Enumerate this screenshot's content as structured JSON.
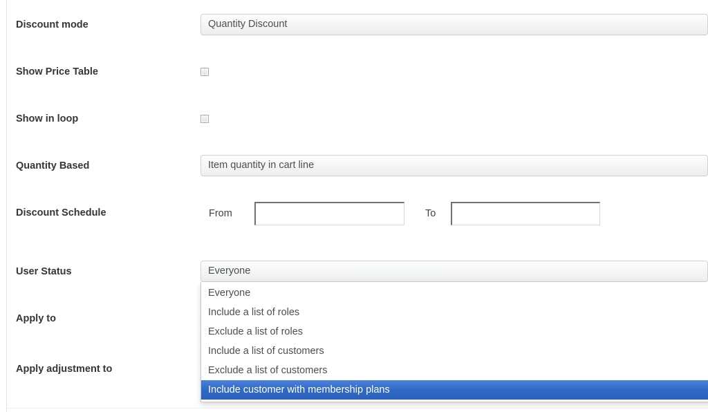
{
  "form": {
    "rows": [
      {
        "id": "discount-mode",
        "label": "Discount mode",
        "control": "select",
        "value": "Quantity Discount"
      },
      {
        "id": "show-price-table",
        "label": "Show Price Table",
        "control": "checkbox",
        "checked": false
      },
      {
        "id": "show-in-loop",
        "label": "Show in loop",
        "control": "checkbox",
        "checked": false
      },
      {
        "id": "quantity-based",
        "label": "Quantity Based",
        "control": "select",
        "value": "Item quantity in cart line"
      },
      {
        "id": "discount-schedule",
        "label": "Discount Schedule",
        "control": "date-range",
        "from_label": "From",
        "from_value": "",
        "from_placeholder": "",
        "to_label": "To",
        "to_value": "",
        "to_placeholder": ""
      },
      {
        "id": "user-status",
        "label": "User Status",
        "control": "select-open",
        "value": "Everyone"
      },
      {
        "id": "apply-to",
        "label": "Apply to",
        "control": "none"
      },
      {
        "id": "apply-adjustment-to",
        "label": "Apply adjustment to",
        "control": "none"
      }
    ],
    "user_status_dropdown": {
      "options": [
        "Everyone",
        "Include a list of roles",
        "Exclude a list of roles",
        "Include a list of customers",
        "Exclude a list of customers",
        "Include customer with membership plans"
      ],
      "selected_index": 5,
      "selected_value": "Include customer with membership plans",
      "highlight_color": "#2f68c4",
      "highlight_text_color": "#ffffff"
    }
  },
  "theme": {
    "label_color": "#32373c",
    "field_text_color": "#4a4f54",
    "border_color": "#cfd3d7",
    "background": "#ffffff",
    "accent": "#2f68c4"
  }
}
